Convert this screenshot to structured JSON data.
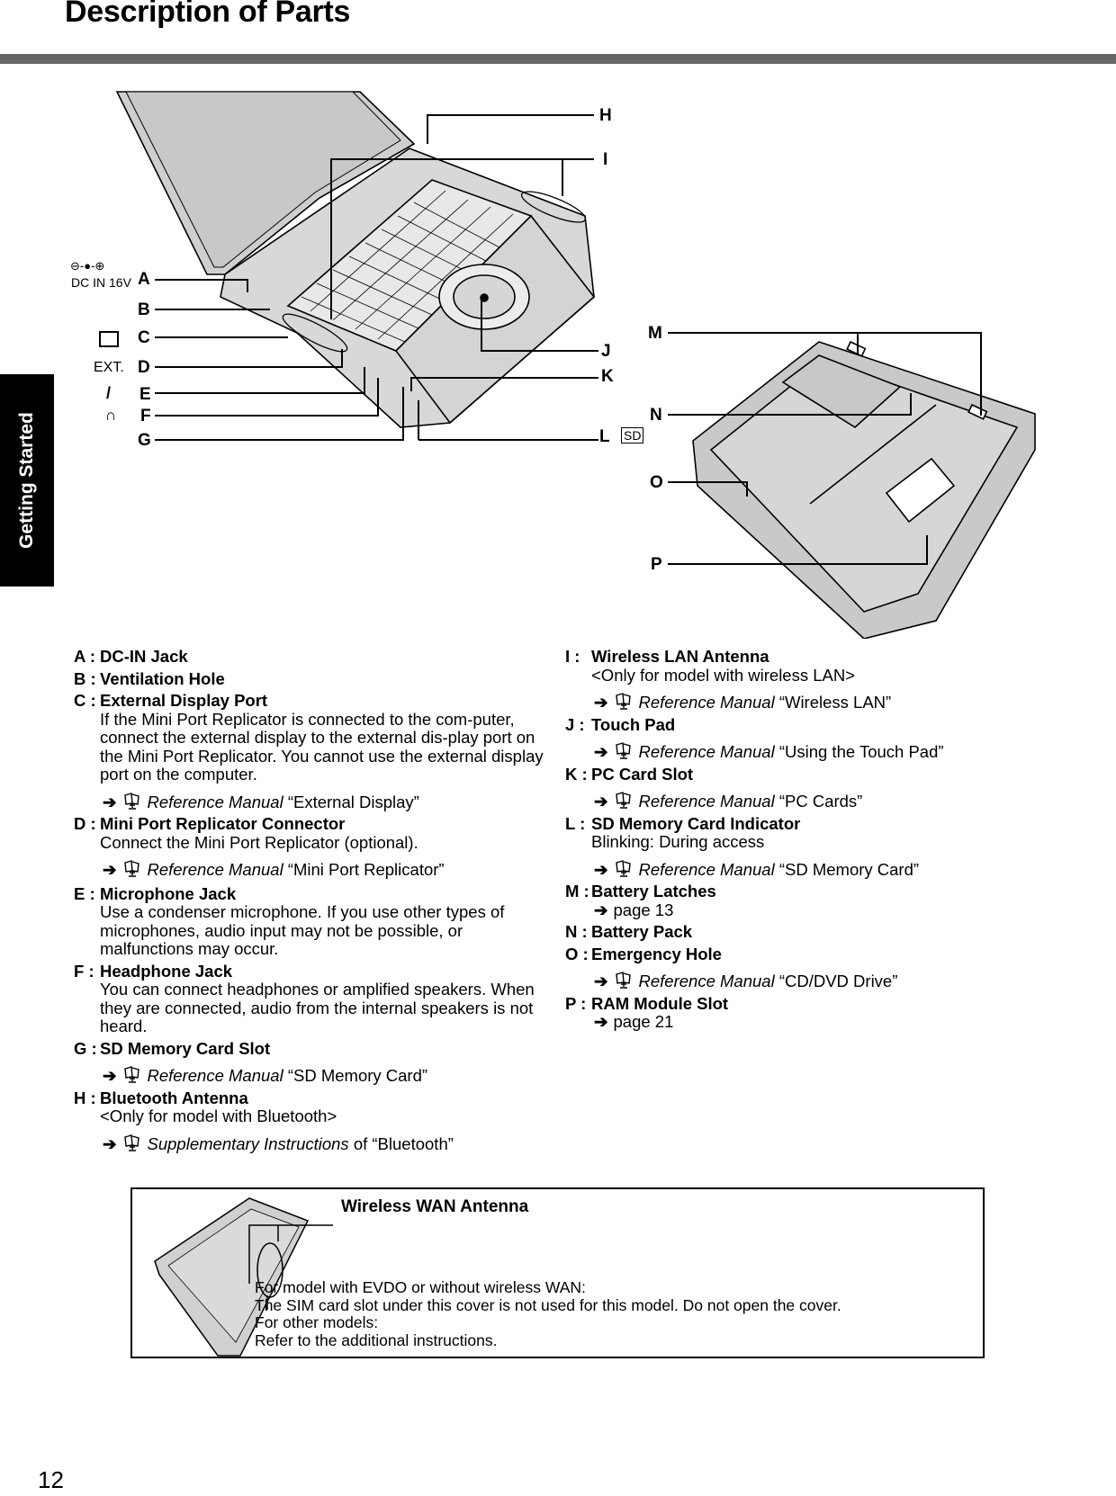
{
  "page": {
    "title": "Description of Parts",
    "side_tab": "Getting Started",
    "page_number": "12"
  },
  "diagram": {
    "callouts": [
      "A",
      "B",
      "C",
      "D",
      "E",
      "F",
      "G",
      "H",
      "I",
      "J",
      "K",
      "L",
      "M",
      "N",
      "O",
      "P"
    ],
    "symbols": {
      "dc_in_polarity": "⊖-●-⊕",
      "dc_in_label": "DC IN 16V",
      "ext_label": "EXT.",
      "sd_label": "SD"
    }
  },
  "parts_left": [
    {
      "key": "A :",
      "name": "DC-IN Jack"
    },
    {
      "key": "B :",
      "name": "Ventilation Hole"
    },
    {
      "key": "C :",
      "name": "External Display Port",
      "desc": "If the Mini Port Replicator is connected to the com-puter, connect the external display to the external dis-play port on the Mini Port Replicator. You cannot use the external display port on the computer.",
      "ref_manual": "Reference Manual",
      "ref_topic": "“External Display”"
    },
    {
      "key": "D :",
      "name": "Mini Port Replicator Connector",
      "desc": "Connect the Mini Port Replicator (optional).",
      "ref_manual": "Reference Manual",
      "ref_topic": "“Mini Port Replicator”"
    },
    {
      "key": "E :",
      "name": "Microphone Jack",
      "desc": "Use a condenser microphone. If you use other types of microphones, audio input may not be possible, or malfunctions may occur."
    },
    {
      "key": "F :",
      "name": "Headphone Jack",
      "desc": "You can connect headphones or amplified speakers. When they are connected, audio from the internal speakers is not heard."
    },
    {
      "key": "G :",
      "name": "SD Memory Card Slot",
      "ref_manual": "Reference Manual",
      "ref_topic": "“SD Memory Card”"
    },
    {
      "key": "H :",
      "name": "Bluetooth Antenna",
      "desc": "<Only for model with Bluetooth>",
      "ref_manual": "Supplementary Instructions",
      "ref_topic": "of “Bluetooth”"
    }
  ],
  "parts_right": [
    {
      "key": "I :",
      "name": "Wireless LAN Antenna",
      "desc": "<Only for model with wireless LAN>",
      "ref_manual": "Reference Manual",
      "ref_topic": "“Wireless LAN”"
    },
    {
      "key": "J :",
      "name": "Touch Pad",
      "ref_manual": "Reference Manual",
      "ref_topic": "“Using the Touch Pad”"
    },
    {
      "key": "K :",
      "name": "PC Card Slot",
      "ref_manual": "Reference Manual",
      "ref_topic": "“PC Cards”"
    },
    {
      "key": "L :",
      "name": "SD Memory Card Indicator",
      "desc": "Blinking: During access",
      "ref_manual": "Reference Manual",
      "ref_topic": "“SD Memory Card”"
    },
    {
      "key": "M :",
      "name": "Battery Latches",
      "page_ref": "page 13"
    },
    {
      "key": "N :",
      "name": "Battery Pack"
    },
    {
      "key": "O :",
      "name": "Emergency Hole",
      "ref_manual": "Reference Manual",
      "ref_topic": "“CD/DVD Drive”"
    },
    {
      "key": "P :",
      "name": "RAM Module Slot",
      "page_ref": "page 21"
    }
  ],
  "arrow_glyph": "➔",
  "wan_box": {
    "title": "Wireless WAN Antenna",
    "notes": [
      "For model with EVDO or without wireless WAN:",
      "The SIM card slot under this cover is not used for this model. Do not open the cover.",
      "For other models:",
      "Refer to the additional instructions."
    ]
  }
}
